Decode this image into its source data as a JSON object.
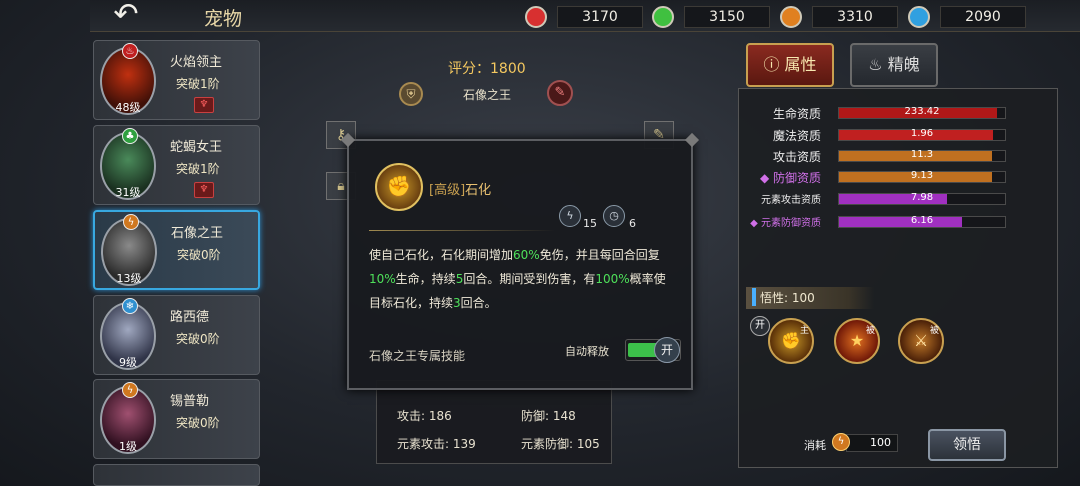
{
  "header": {
    "title": "宠物",
    "back_icon": "back-arrow-icon",
    "currencies": [
      {
        "icon": "red-gem-icon",
        "color": "#d83030",
        "amount": "3170"
      },
      {
        "icon": "green-gem-icon",
        "color": "#40c040",
        "amount": "3150"
      },
      {
        "icon": "orange-bolt-icon",
        "color": "#e08020",
        "amount": "3310"
      },
      {
        "icon": "blue-snowflake-icon",
        "color": "#30a0e0",
        "amount": "2090"
      }
    ]
  },
  "pets": [
    {
      "name": "火焰领主",
      "stage": "突破1阶",
      "level": "48级",
      "element": "fire",
      "has_badge": true
    },
    {
      "name": "蛇蝎女王",
      "stage": "突破1阶",
      "level": "31级",
      "element": "nature",
      "has_badge": true
    },
    {
      "name": "石像之王",
      "stage": "突破0阶",
      "level": "13级",
      "element": "lightning",
      "selected": true
    },
    {
      "name": "路西德",
      "stage": "突破0阶",
      "level": "9级",
      "element": "ice"
    },
    {
      "name": "锡普勒",
      "stage": "突破0阶",
      "level": "1级",
      "element": "lightning"
    }
  ],
  "detail": {
    "score": "评分：1800",
    "pet_name": "石像之王"
  },
  "stats": {
    "attack": "攻击: 186",
    "defense": "防御: 148",
    "elem_attack": "元素攻击: 139",
    "elem_defense": "元素防御: 105"
  },
  "skill_popup": {
    "grade": "[高级]",
    "name": "石化",
    "cost_value": "15",
    "cooldown_value": "6",
    "desc": {
      "p1": "使自己石化，石化期间增加",
      "v1": "60%",
      "p2": "免伤，并且每回合回复",
      "v2": "10%",
      "p3": "生命，持续",
      "v3": "5",
      "p4": "回合。期间受到伤害，有",
      "v4": "100%",
      "p5": "概率使目标石化，持续",
      "v5": "3",
      "p6": "回合。"
    },
    "footer": "石像之王专属技能",
    "auto_label": "自动释放",
    "toggle_label": "开"
  },
  "right_panel": {
    "tabs": [
      {
        "label": "属性",
        "active": true
      },
      {
        "label": "精魄",
        "active": false
      }
    ],
    "attributes": [
      {
        "label": "生命资质",
        "value": "233.42",
        "fill": 0.95,
        "color": "#b01818",
        "style": "normal"
      },
      {
        "label": "魔法资质",
        "value": "1.96",
        "fill": 0.93,
        "color": "#c02020",
        "style": "normal"
      },
      {
        "label": "攻击资质",
        "value": "11.3",
        "fill": 0.92,
        "color": "#c07020",
        "style": "normal"
      },
      {
        "label": "◆ 防御资质",
        "value": "9.13",
        "fill": 0.92,
        "color": "#c07020",
        "style": "purple"
      },
      {
        "label": "元素攻击资质",
        "value": "7.98",
        "fill": 0.65,
        "color": "#a030c0",
        "style": "small"
      },
      {
        "label": "◆ 元素防御资质",
        "value": "6.16",
        "fill": 0.74,
        "color": "#a030c0",
        "style": "small-purple"
      }
    ],
    "wisdom": "悟性: 100",
    "open_tag": "开",
    "talents": [
      {
        "tag": "主",
        "icon": "petrify-skill-icon"
      },
      {
        "tag": "被",
        "icon": "star-burst-skill-icon"
      },
      {
        "tag": "被",
        "icon": "slash-skill-icon"
      }
    ],
    "cost_label": "消耗",
    "cost_value": "100",
    "learn_button": "领悟"
  }
}
